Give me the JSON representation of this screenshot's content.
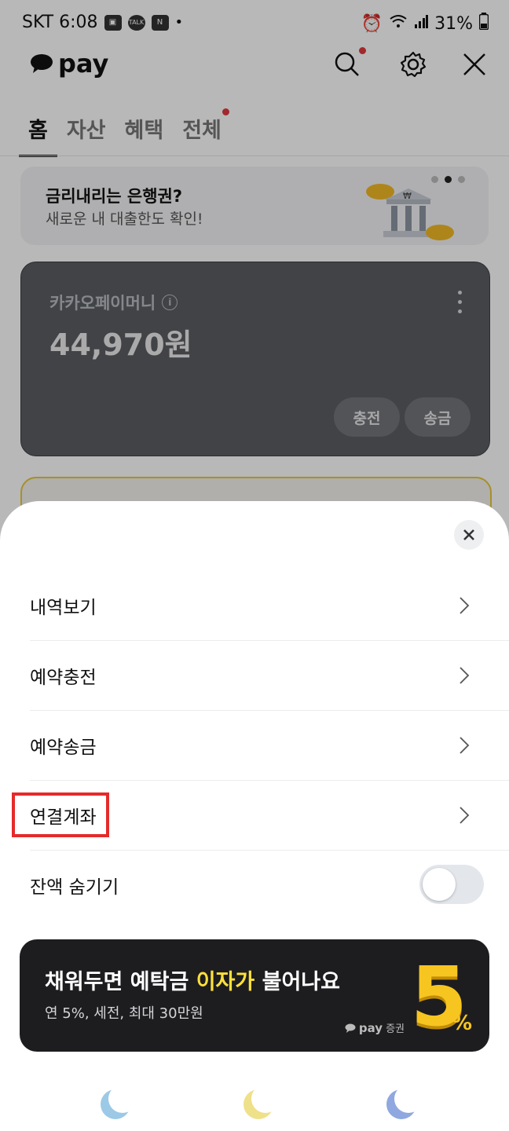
{
  "status_bar": {
    "left_text": "SKT 6:08",
    "battery": "31%",
    "talk_badge": "TALK",
    "n_badge": "N"
  },
  "header": {
    "logo_text": "pay"
  },
  "tabs": [
    {
      "label": "홈",
      "active": true
    },
    {
      "label": "자산",
      "active": false
    },
    {
      "label": "혜택",
      "active": false
    },
    {
      "label": "전체",
      "active": false
    }
  ],
  "banner": {
    "title": "금리내리는 은행권?",
    "subtitle": "새로운 내 대출한도 확인!",
    "page_index": 2,
    "page_count": 3
  },
  "money_card": {
    "label": "카카오페이머니",
    "amount": "44,970원",
    "charge_label": "충전",
    "send_label": "송금"
  },
  "sheet": {
    "menu": [
      {
        "label": "내역보기"
      },
      {
        "label": "예약충전"
      },
      {
        "label": "예약송금"
      },
      {
        "label": "연결계좌"
      }
    ],
    "hide_balance_label": "잔액 숨기기",
    "hide_balance_on": false
  },
  "promo": {
    "title_part1": "채워두면 예탁금 ",
    "title_highlight": "이자가",
    "title_part2": " 불어나요",
    "subtitle": "연 5%, 세전, 최대 30만원",
    "brand_pay": "pay",
    "brand_suffix": "증권",
    "big_number": "5",
    "big_suffix": "%"
  },
  "colors": {
    "accent_yellow": "#ffe03a",
    "highlight_red": "#e52a2a",
    "card_dark": "#5b5d62",
    "notification_dot": "#e0383e"
  }
}
